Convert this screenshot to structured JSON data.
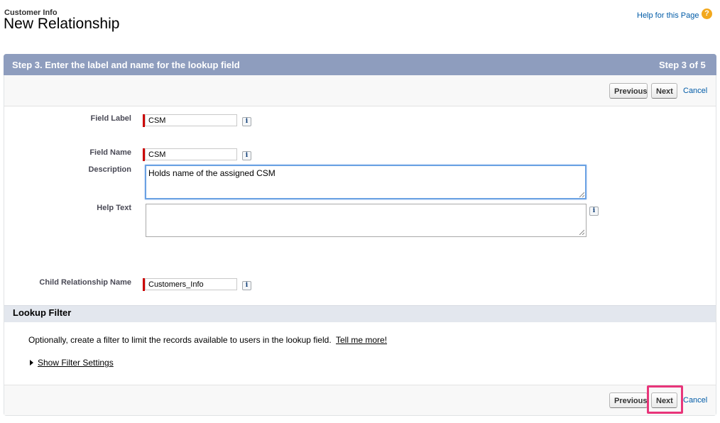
{
  "header": {
    "breadcrumb": "Customer Info",
    "title": "New Relationship",
    "help_link": "Help for this Page",
    "help_icon": "question-circle-icon"
  },
  "step": {
    "title": "Step 3. Enter the label and name for the lookup field",
    "count": "Step 3 of 5"
  },
  "buttons": {
    "previous": "Previous",
    "next": "Next",
    "cancel": "Cancel"
  },
  "form": {
    "field_label": {
      "label": "Field Label",
      "value": "CSM"
    },
    "field_name": {
      "label": "Field Name",
      "value": "CSM"
    },
    "description": {
      "label": "Description",
      "value": "Holds name of the assigned CSM"
    },
    "help_text": {
      "label": "Help Text",
      "value": ""
    },
    "child_relationship_name": {
      "label": "Child Relationship Name",
      "value": "Customers_Info"
    },
    "info_icon_glyph": "i"
  },
  "lookup_filter": {
    "title": "Lookup Filter",
    "description": "Optionally, create a filter to limit the records available to users in the lookup field.",
    "tell_me_more": "Tell me more!",
    "show_settings": "Show Filter Settings"
  },
  "colors": {
    "step_header_bg": "#8e9dbe",
    "required_marker": "#cc0000",
    "link": "#015ba7",
    "highlight": "#e8357a"
  }
}
